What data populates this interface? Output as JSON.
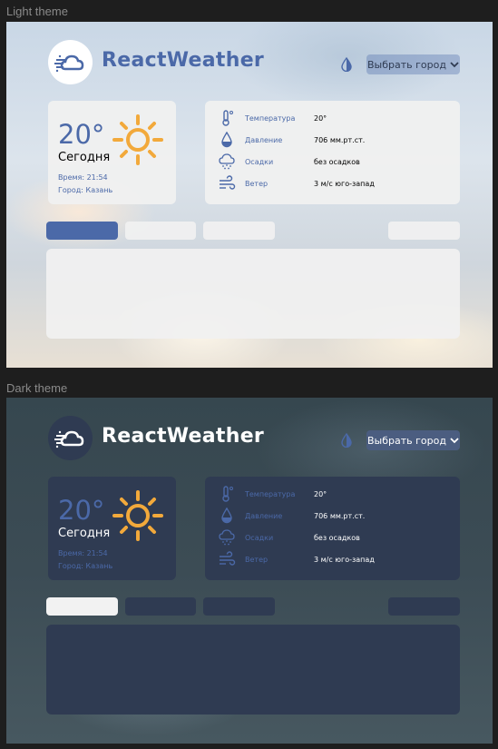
{
  "labels": {
    "light": "Light theme",
    "dark": "Dark theme"
  },
  "app": {
    "brand": "ReactWeather",
    "city_select_label": "Выбрать город"
  },
  "today": {
    "temperature": "20°",
    "day": "Сегодня",
    "time": "Время: 21:54",
    "city": "Город: Казань"
  },
  "details": [
    {
      "label": "Температура",
      "value": "20°",
      "icon": "thermometer-icon"
    },
    {
      "label": "Давление",
      "value": "706 мм.рт.ст.",
      "icon": "pressure-drop-icon"
    },
    {
      "label": "Осадки",
      "value": "без осадков",
      "icon": "precipitation-icon"
    },
    {
      "label": "Ветер",
      "value": "3 м/с   юго-запад",
      "icon": "wind-icon"
    }
  ],
  "colors": {
    "accent": "#4b69a8",
    "sun": "#f2a93b",
    "dark_card": "#2f3b52",
    "light_card": "#f0f0f0"
  }
}
